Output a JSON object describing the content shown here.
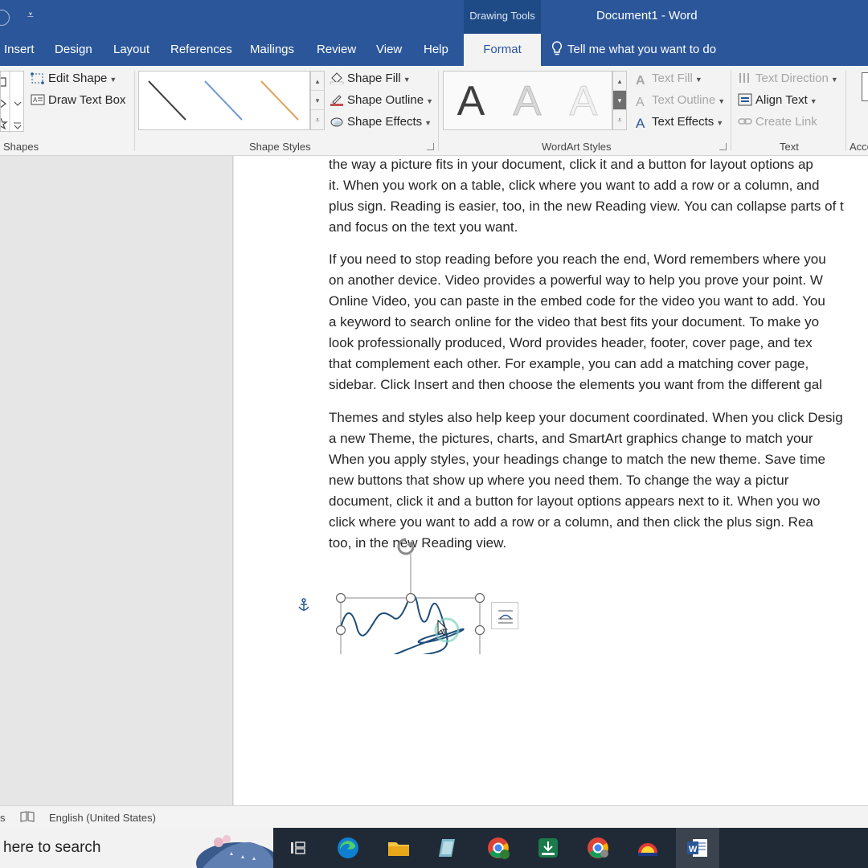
{
  "titlebar": {
    "qat_symbol": "⩡",
    "contextual_tab": "Drawing Tools",
    "document_title": "Document1  -  Word"
  },
  "tabs": [
    {
      "label": "Insert"
    },
    {
      "label": "Design"
    },
    {
      "label": "Layout"
    },
    {
      "label": "References"
    },
    {
      "label": "Mailings"
    },
    {
      "label": "Review"
    },
    {
      "label": "View"
    },
    {
      "label": "Help"
    },
    {
      "label": "Format",
      "active": true
    }
  ],
  "tell_me": "Tell me what you want to do",
  "ribbon": {
    "insert_shapes": {
      "edit_shape": "Edit Shape",
      "draw_text_box": "Draw Text Box",
      "label": "Shapes"
    },
    "shape_styles": {
      "fill": "Shape Fill",
      "outline": "Shape Outline",
      "effects": "Shape Effects",
      "label": "Shape Styles",
      "swatches": [
        "#404040",
        "#6f9bd1",
        "#e0a35a"
      ]
    },
    "wordart": {
      "letters": [
        "A",
        "A",
        "A"
      ],
      "text_fill": "Text Fill",
      "text_outline": "Text Outline",
      "text_effects": "Text Effects",
      "label": "WordArt Styles"
    },
    "text": {
      "text_direction": "Text Direction",
      "align_text": "Align Text",
      "create_link": "Create Link",
      "label": "Text"
    },
    "accessibility_label": "Acce"
  },
  "document": {
    "paragraphs": [
      [
        "the way a picture fits in your document, click it and a button for layout options ap",
        "it. When you work on a table, click where you want to add a row or a column, and",
        "plus sign. Reading is easier, too, in the new Reading view. You can collapse parts of t",
        "and focus on the text you want."
      ],
      [
        "If you need to stop reading before you reach the end, Word remembers where you",
        "on another device. Video provides a powerful way to help you prove your point. W",
        "Online Video, you can paste in the embed code for the video you want to add. You",
        "a keyword to search online for the video that best fits your document. To make yo",
        "look professionally produced, Word provides header, footer, cover page, and tex",
        "that complement each other. For example, you can add a matching cover page,",
        "sidebar. Click Insert and then choose the elements you want from the different gal"
      ],
      [
        "Themes and styles also help keep your document coordinated. When you click Desig",
        "a new Theme, the pictures, charts, and SmartArt graphics change to match your",
        "When you apply styles, your headings change to match the new theme. Save time",
        "new buttons that show up where you need them. To change the way a pictur",
        "document, click it and a button for layout options appears next to it. When you wo",
        "click where you want to add a row or a column, and then click the plus sign. Rea",
        "too, in the new Reading view."
      ]
    ]
  },
  "statusbar": {
    "left_fragment": "s",
    "language": "English (United States)"
  },
  "taskbar": {
    "search_text": "here to search"
  }
}
